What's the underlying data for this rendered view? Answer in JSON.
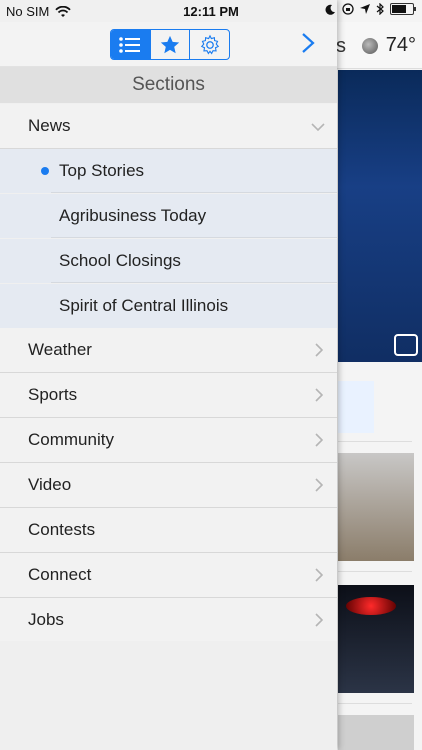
{
  "status": {
    "carrier": "No SIM",
    "time": "12:11 PM"
  },
  "background": {
    "title_fragment": "s",
    "temperature": "74°"
  },
  "drawer": {
    "segmented": [
      {
        "icon": "list-icon",
        "active": true
      },
      {
        "icon": "star-icon",
        "active": false
      },
      {
        "icon": "gear-icon",
        "active": false
      }
    ],
    "sections_title": "Sections",
    "items": [
      {
        "label": "News",
        "type": "expanded"
      },
      {
        "label": "Top Stories",
        "type": "sub",
        "selected": true
      },
      {
        "label": "Agribusiness Today",
        "type": "sub"
      },
      {
        "label": "School Closings",
        "type": "sub"
      },
      {
        "label": "Spirit of Central Illinois",
        "type": "sub"
      },
      {
        "label": "Weather",
        "type": "chevron"
      },
      {
        "label": "Sports",
        "type": "chevron"
      },
      {
        "label": "Community",
        "type": "chevron"
      },
      {
        "label": "Video",
        "type": "chevron"
      },
      {
        "label": "Contests",
        "type": "none"
      },
      {
        "label": "Connect",
        "type": "chevron"
      },
      {
        "label": "Jobs",
        "type": "chevron"
      }
    ]
  },
  "colors": {
    "accent": "#1a7cf0"
  }
}
